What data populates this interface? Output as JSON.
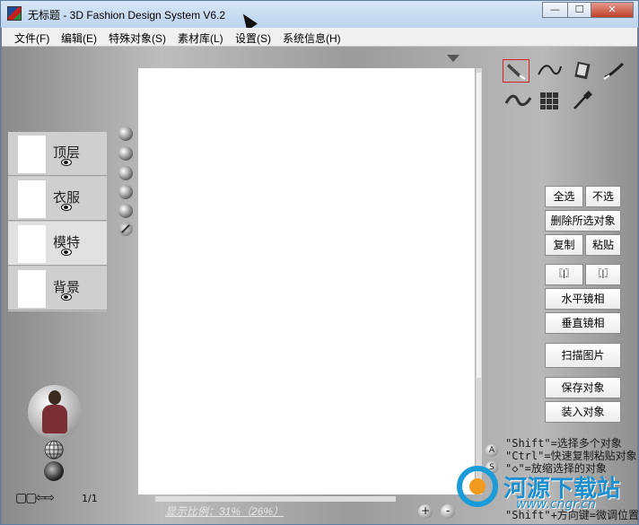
{
  "window": {
    "title": "无标题 - 3D Fashion Design System V6.2",
    "controls": {
      "minimize": "—",
      "maximize": "☐",
      "close": "✕"
    }
  },
  "menu": [
    "文件(F)",
    "编辑(E)",
    "特殊对象(S)",
    "素材库(L)",
    "设置(S)",
    "系统信息(H)"
  ],
  "layers": [
    {
      "name": "顶层"
    },
    {
      "name": "衣服"
    },
    {
      "name": "模特"
    },
    {
      "name": "背景"
    }
  ],
  "canvas": {
    "zoom_label": "显示比例：31%（26%）"
  },
  "navigator": {
    "page_count": "1/1"
  },
  "tools": [
    "pen-tool",
    "curve-tool",
    "fill-tool",
    "brush-tool",
    "wave-tool",
    "grid-tool",
    "eyedropper-tool"
  ],
  "buttons": {
    "select_all": "全选",
    "deselect": "不选",
    "delete_selected": "删除所选对象",
    "copy": "复制",
    "paste": "粘贴",
    "bring_front": "〖|〗",
    "send_back": "〖|〗",
    "flip_h": "水平镜相",
    "flip_v": "垂直镜相",
    "scan": "扫描图片",
    "save_obj": "保存对象",
    "load_obj": "装入对象"
  },
  "hints": [
    "\"Shift\"=选择多个对象",
    "\"Ctrl\"=快速复制粘贴对象",
    "\"◇\"=放缩选择的对象",
    "\"Shift\"+方向键=微调位置"
  ],
  "hint_keys": [
    "A",
    "S"
  ],
  "zoom_buttons": [
    "+",
    "-"
  ],
  "watermark": {
    "title": "河源下载站",
    "url": "www.cngr.cn"
  }
}
